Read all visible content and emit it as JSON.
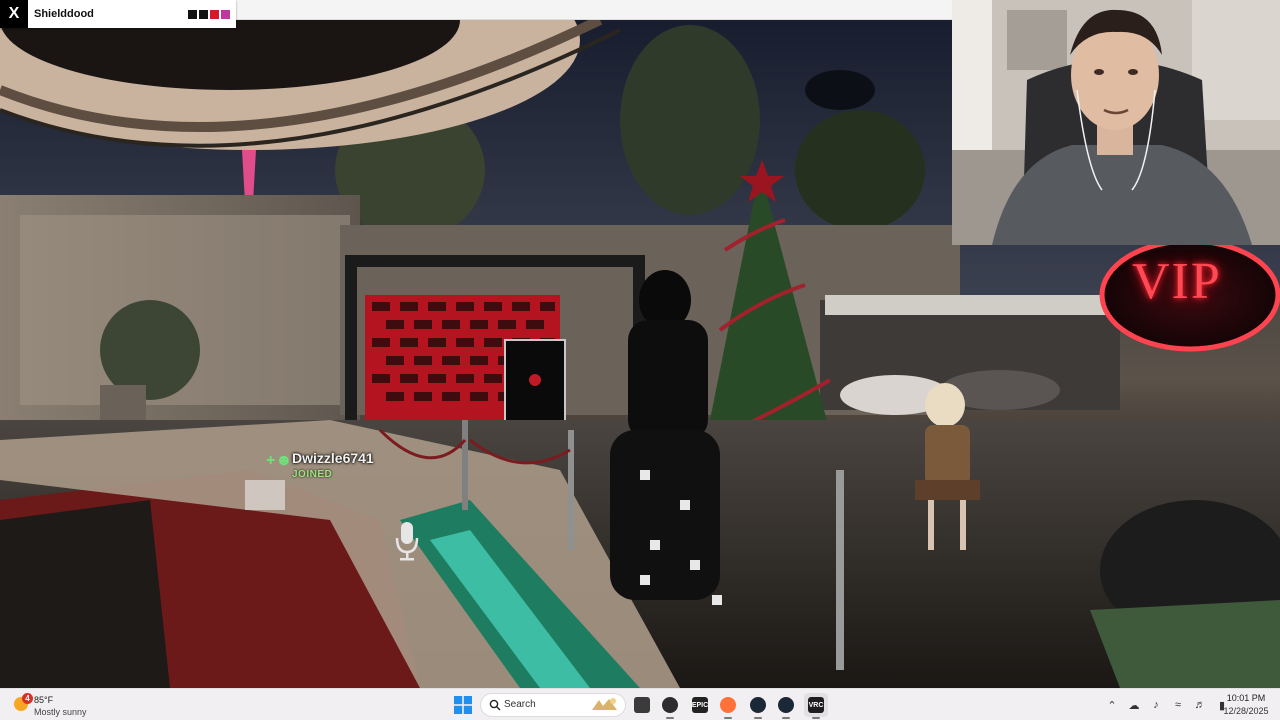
{
  "window": {
    "logo": "X",
    "title": "Shielddood",
    "swatch_colors": [
      "#111111",
      "#111111",
      "#d11b2a",
      "#c0369f"
    ]
  },
  "scene": {
    "player_name": "Dwizzle6741",
    "player_status": "JOINED",
    "sign_text": "VIP",
    "icons": [
      "user-joined-icon",
      "microphone-icon"
    ]
  },
  "taskbar": {
    "weather": {
      "badge": "4",
      "temp": "85°F",
      "condition": "Mostly sunny"
    },
    "search_label": "Search",
    "apps": [
      {
        "name": "file-explorer",
        "color": "#3b3b3b"
      },
      {
        "name": "obs",
        "color": "#2d2d2d"
      },
      {
        "name": "epic-games",
        "color": "#222222",
        "text": "EPIC"
      },
      {
        "name": "firefox",
        "color": "#ff7139"
      },
      {
        "name": "steam",
        "color": "#1b2838"
      },
      {
        "name": "steam-2",
        "color": "#1b2838"
      },
      {
        "name": "vrchat",
        "color": "#1e1e1e",
        "text": "VRC"
      }
    ],
    "tray_icons": [
      "chevron-up-icon",
      "cloud-icon",
      "mic-icon",
      "wifi-icon",
      "volume-icon",
      "battery-icon"
    ],
    "time": "10:01 PM",
    "date": "12/28/2025"
  }
}
